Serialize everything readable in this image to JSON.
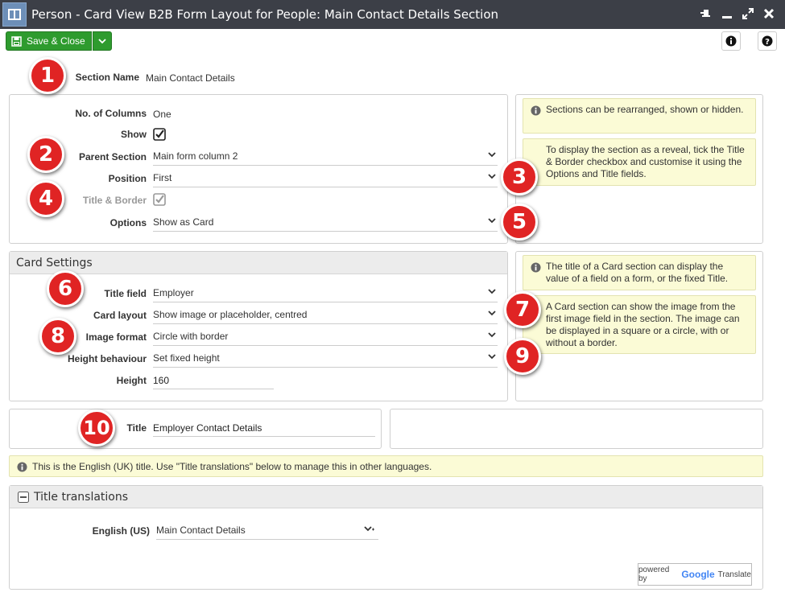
{
  "window": {
    "title": "Person - Card View B2B Form Layout for People: Main Contact Details Section"
  },
  "toolbar": {
    "save_label": "Save & Close"
  },
  "section": {
    "name_label": "Section Name",
    "name_value": "Main Contact Details"
  },
  "main_panel": {
    "columns_label": "No. of Columns",
    "columns_value": "One",
    "show_label": "Show",
    "parent_label": "Parent Section",
    "parent_value": "Main form column 2",
    "position_label": "Position",
    "position_value": "First",
    "title_border_label": "Title & Border",
    "options_label": "Options",
    "options_value": "Show as Card"
  },
  "notes": {
    "note1": "Sections can be rearranged, shown or hidden.",
    "note2": "To display the section as a reveal, tick the Title & Border checkbox and customise it using the Options and Title fields.",
    "note3": "The title of a Card section can display the value of a field on a form, or the fixed Title.",
    "note4": "A Card section can show the image from the first image field in the section. The image can be displayed in a square or a circle, with or without a border.",
    "english_note": "This is the English (UK) title. Use \"Title translations\" below to manage this in other languages."
  },
  "card_settings": {
    "header": "Card Settings",
    "title_field_label": "Title field",
    "title_field_value": "Employer",
    "layout_label": "Card layout",
    "layout_value": "Show image or placeholder, centred",
    "image_format_label": "Image format",
    "image_format_value": "Circle with border",
    "height_behaviour_label": "Height behaviour",
    "height_behaviour_value": "Set fixed height",
    "height_label": "Height",
    "height_value": "160"
  },
  "title_panel": {
    "title_label": "Title",
    "title_value": "Employer Contact Details"
  },
  "translations": {
    "header": "Title translations",
    "english_us_label": "English (US)",
    "english_us_value": "Main Contact Details"
  },
  "google_translate": {
    "powered_by": "powered by",
    "google": "Google",
    "translate": "Translate"
  },
  "badges": [
    "1",
    "2",
    "3",
    "4",
    "5",
    "6",
    "7",
    "8",
    "9",
    "10"
  ],
  "colors": {
    "save_green": "#2e9b2e",
    "badge_red": "#e02424",
    "note_yellow": "#fbfbd6",
    "titlebar": "#3c3f47"
  }
}
